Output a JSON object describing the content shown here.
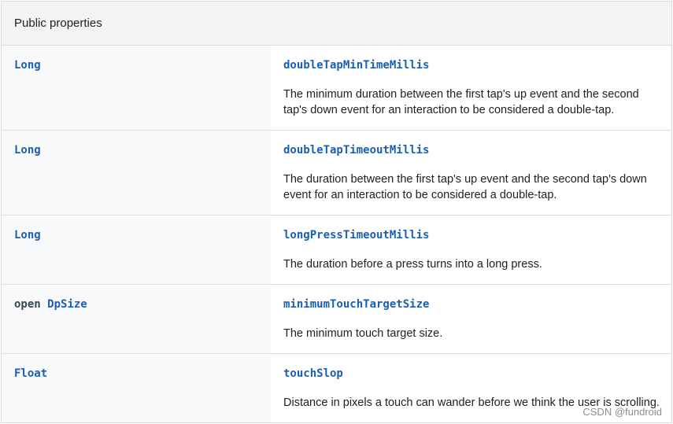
{
  "table": {
    "header": "Public properties",
    "rows": [
      {
        "type_prefix": "",
        "type_link": "Long",
        "name": "doubleTapMinTimeMillis",
        "description": "The minimum duration between the first tap's up event and the second tap's down event for an interaction to be considered a double-tap."
      },
      {
        "type_prefix": "",
        "type_link": "Long",
        "name": "doubleTapTimeoutMillis",
        "description": "The duration between the first tap's up event and the second tap's down event for an interaction to be considered a double-tap."
      },
      {
        "type_prefix": "",
        "type_link": "Long",
        "name": "longPressTimeoutMillis",
        "description": "The duration before a press turns into a long press."
      },
      {
        "type_prefix": "open ",
        "type_link": "DpSize",
        "name": "minimumTouchTargetSize",
        "description": "The minimum touch target size."
      },
      {
        "type_prefix": "",
        "type_link": "Float",
        "name": "touchSlop",
        "description": "Distance in pixels a touch can wander before we think the user is scrolling."
      }
    ]
  },
  "watermark": "CSDN @fundroid"
}
